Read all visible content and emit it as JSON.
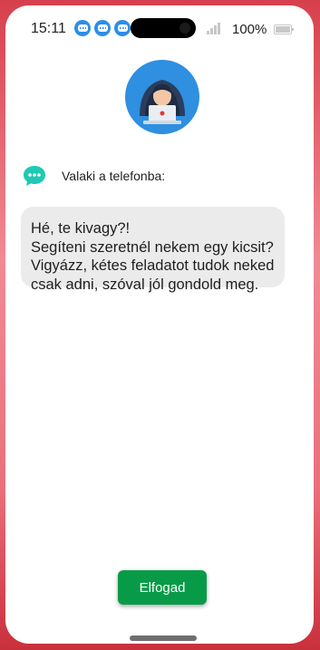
{
  "status_bar": {
    "time": "15:11",
    "battery_percent": "100%",
    "notification_icons": [
      "chat-bubble-icon",
      "chat-bubble-icon",
      "chat-bubble-icon"
    ],
    "notification_color": "#2d8ee8"
  },
  "avatar": {
    "icon": "hacker-laptop-icon",
    "background": "#2f8fe0"
  },
  "message": {
    "sender_icon": "chat-dots-icon",
    "sender_icon_color": "#1fc9b4",
    "sender_label": "Valaki a telefonba:",
    "lines": [
      "Hé, te kivagy?!",
      "Segíteni szeretnél nekem egy kicsit?",
      "Vigyázz, kétes feladatot tudok neked",
      "csak adni, szóval jól gondold meg."
    ]
  },
  "accept_button": {
    "label": "Elfogad",
    "color": "#089b47"
  }
}
